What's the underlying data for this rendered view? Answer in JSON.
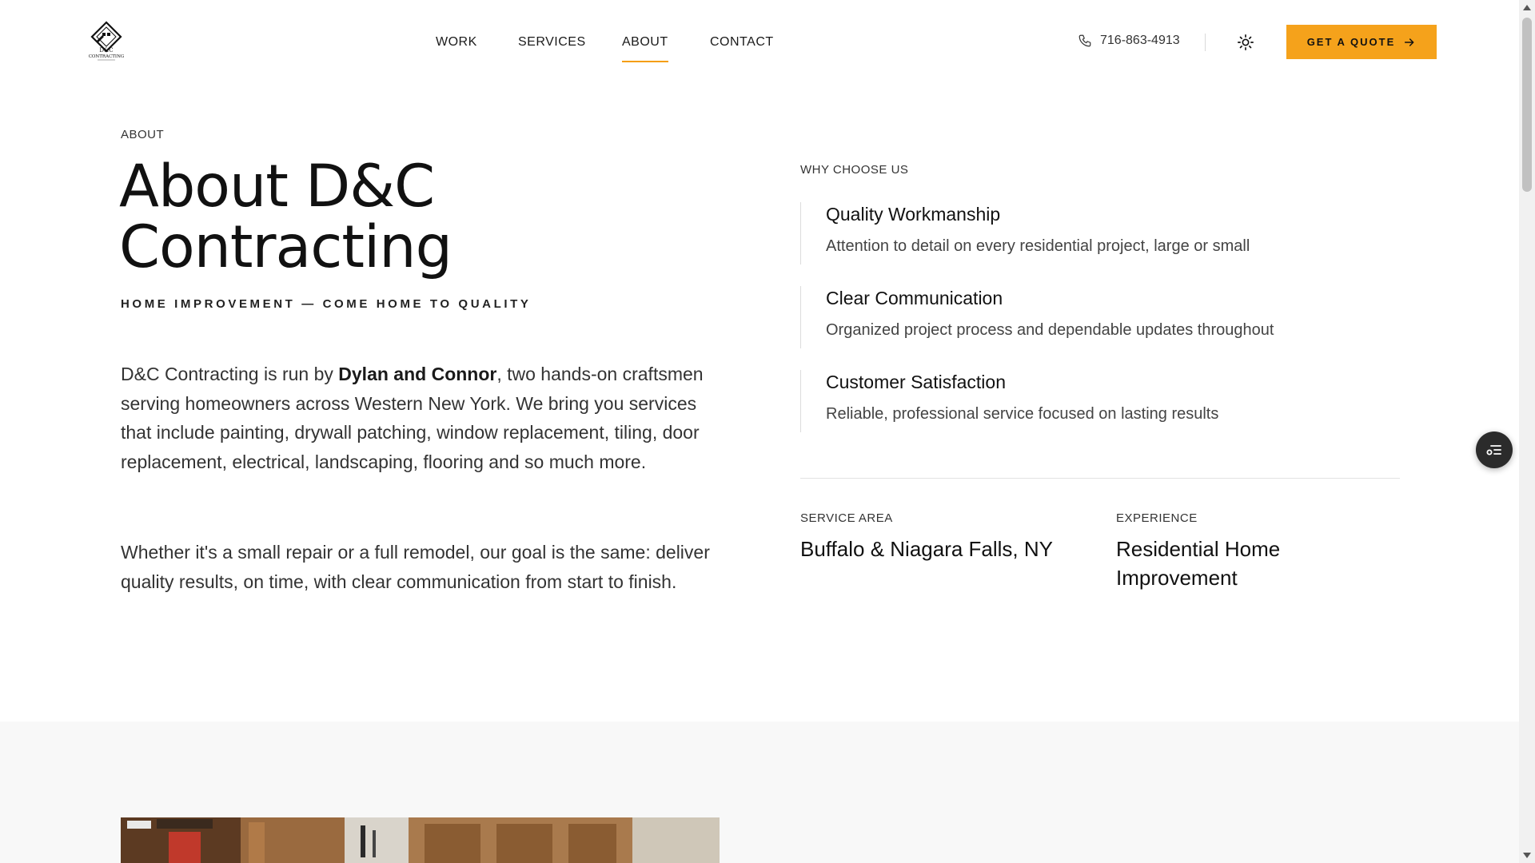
{
  "header": {
    "logo_alt": "D&C CONTRACTING",
    "logo_line1": "D&C",
    "logo_line2": "CONTRACTING",
    "nav": [
      {
        "label": "WORK"
      },
      {
        "label": "SERVICES"
      },
      {
        "label": "ABOUT",
        "active": true
      },
      {
        "label": "CONTACT"
      }
    ],
    "phone": "716-863-4913",
    "quote_label": "GET A QUOTE",
    "accent_color": "#f5a21b"
  },
  "about": {
    "eyebrow": "ABOUT",
    "title": "About D&C Contracting",
    "tagline": "HOME IMPROVEMENT — COME HOME TO QUALITY",
    "para1_prefix": "D&C Contracting is run by ",
    "para1_names": "Dylan and Connor",
    "para1_suffix": ", two hands-on craftsmen serving homeowners across Western New York. We bring you services that include painting, drywall patching, window replacement, tiling, door replacement, electrical, landscaping, flooring and so much more.",
    "para2": "Whether it's a small repair or a full remodel, our goal is the same: deliver quality results, on time, with clear communication from start to finish."
  },
  "why": {
    "title": "WHY CHOOSE US",
    "features": [
      {
        "title": "Quality Workmanship",
        "desc": "Attention to detail on every residential project, large or small"
      },
      {
        "title": "Clear Communication",
        "desc": "Organized project process and dependable updates throughout"
      },
      {
        "title": "Customer Satisfaction",
        "desc": "Reliable, professional service focused on lasting results"
      }
    ],
    "service_area_label": "SERVICE AREA",
    "service_area_value": "Buffalo & Niagara Falls, NY",
    "experience_label": "EXPERIENCE",
    "experience_value": "Residential Home Improvement"
  },
  "icons": {
    "phone": "phone-icon",
    "theme": "sun-icon",
    "quote_arrow": "arrow-right-icon",
    "floating": "list-settings-icon"
  }
}
